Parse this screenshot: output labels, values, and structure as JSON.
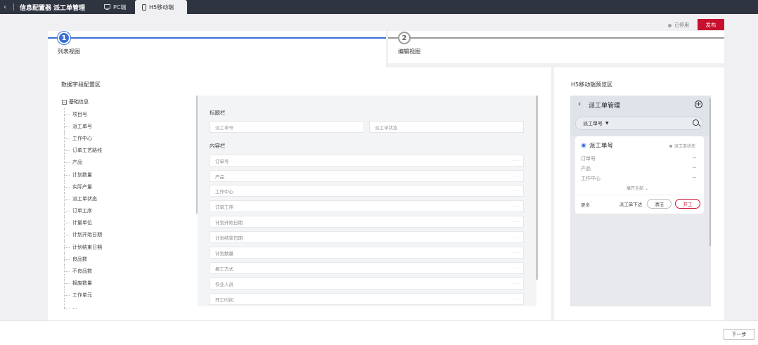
{
  "topbar": {
    "back_icon": "chevron-left-icon",
    "title": "信息配置器",
    "subtitle": "派工单管理",
    "tabs": [
      {
        "label": "PC端",
        "icon": "monitor-icon",
        "active": false
      },
      {
        "label": "H5移动端",
        "icon": "mobile-icon",
        "active": true
      }
    ]
  },
  "status": {
    "label": "已停用"
  },
  "publish_label": "发布",
  "steps": [
    {
      "number": "1",
      "label": "列表视图",
      "active": true
    },
    {
      "number": "2",
      "label": "编辑视图",
      "active": false
    }
  ],
  "fields_panel": {
    "title": "数据字段配置区",
    "root_label": "基础信息",
    "items": [
      "项目号",
      "派工单号",
      "工作中心",
      "订单工艺路线",
      "产品",
      "计划数量",
      "实际产量",
      "派工单状态",
      "订单工序",
      "计量单位",
      "计划开始日期",
      "计划结束日期",
      "良品数",
      "不良品数",
      "报废数量",
      "工作单元",
      "..."
    ]
  },
  "layout": {
    "title_section": "标题栏",
    "title_fields": [
      "派工单号",
      "派工单状态"
    ],
    "content_section": "内容栏",
    "content_rows": [
      "订单号",
      "产品",
      "工作中心",
      "订单工序",
      "计划开始日期",
      "计划结束日期",
      "计划数量",
      "报工方式",
      "作业人员",
      "开工时间"
    ],
    "row_more": "···"
  },
  "preview": {
    "title": "H5移动端预览区",
    "header_title": "派工单管理",
    "search_label": "派工单号",
    "card": {
      "title": "派工单号",
      "status": "派工单状态",
      "fields": [
        {
          "label": "订单号",
          "value": "--"
        },
        {
          "label": "产品",
          "value": "--"
        },
        {
          "label": "工作中心",
          "value": "--"
        }
      ],
      "expand_label": "展开全部",
      "more_label": "更多",
      "buttons": {
        "dispatch": "派工单下达",
        "clean": "清洁",
        "start": "开工"
      }
    }
  },
  "next_label": "下一步"
}
